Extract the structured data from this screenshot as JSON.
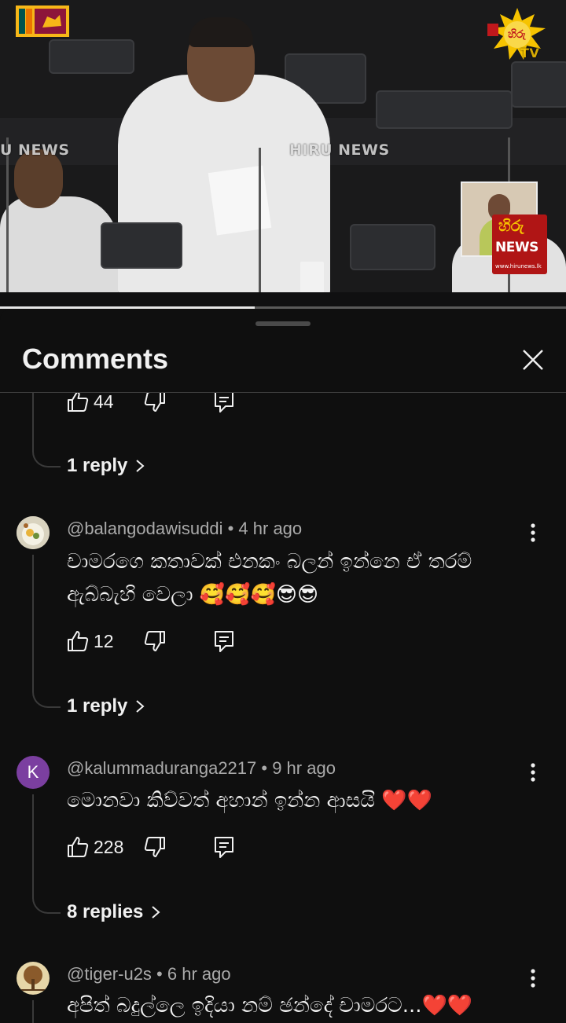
{
  "video": {
    "watermark_left": "U NEWS",
    "watermark_center": "HIRU NEWS",
    "logo_text": "TV",
    "pip_badge_top": "හිරු",
    "pip_badge_news": "NEWS",
    "pip_badge_url": "www.hirunews.lk",
    "progress_fraction": 0.45
  },
  "comments_panel": {
    "title": "Comments"
  },
  "partial_comment": {
    "like_count": "44",
    "replies_label": "1 reply"
  },
  "comments": [
    {
      "author": "@balangodawisuddi",
      "time": "4 hr ago",
      "text": "චාමරගෙ කතාවක් එනකං බලන් ඉන්නෙ ඒ තරම් ඇබ්බැහි වෙලා 🥰🥰🥰😎😎",
      "like_count": "12",
      "replies_label": "1 reply"
    },
    {
      "author": "@kalummaduranga2217",
      "avatar_letter": "K",
      "avatar_color": "#7b3fa0",
      "time": "9 hr ago",
      "text": "මොනවා කිව්වත් අහාන් ඉන්න ආසයි ❤️❤️",
      "like_count": "228",
      "replies_label": "8 replies"
    },
    {
      "author": "@tiger-u2s",
      "time": "6 hr ago",
      "text": "අපිත් බදුල්ලෙ ඉදියා නම් ඡන්දේ චාමරට...❤️❤️"
    }
  ],
  "icons": {
    "like": "thumbs-up-icon",
    "dislike": "thumbs-down-icon",
    "reply": "reply-icon",
    "more": "more-vert-icon",
    "close": "close-icon"
  }
}
